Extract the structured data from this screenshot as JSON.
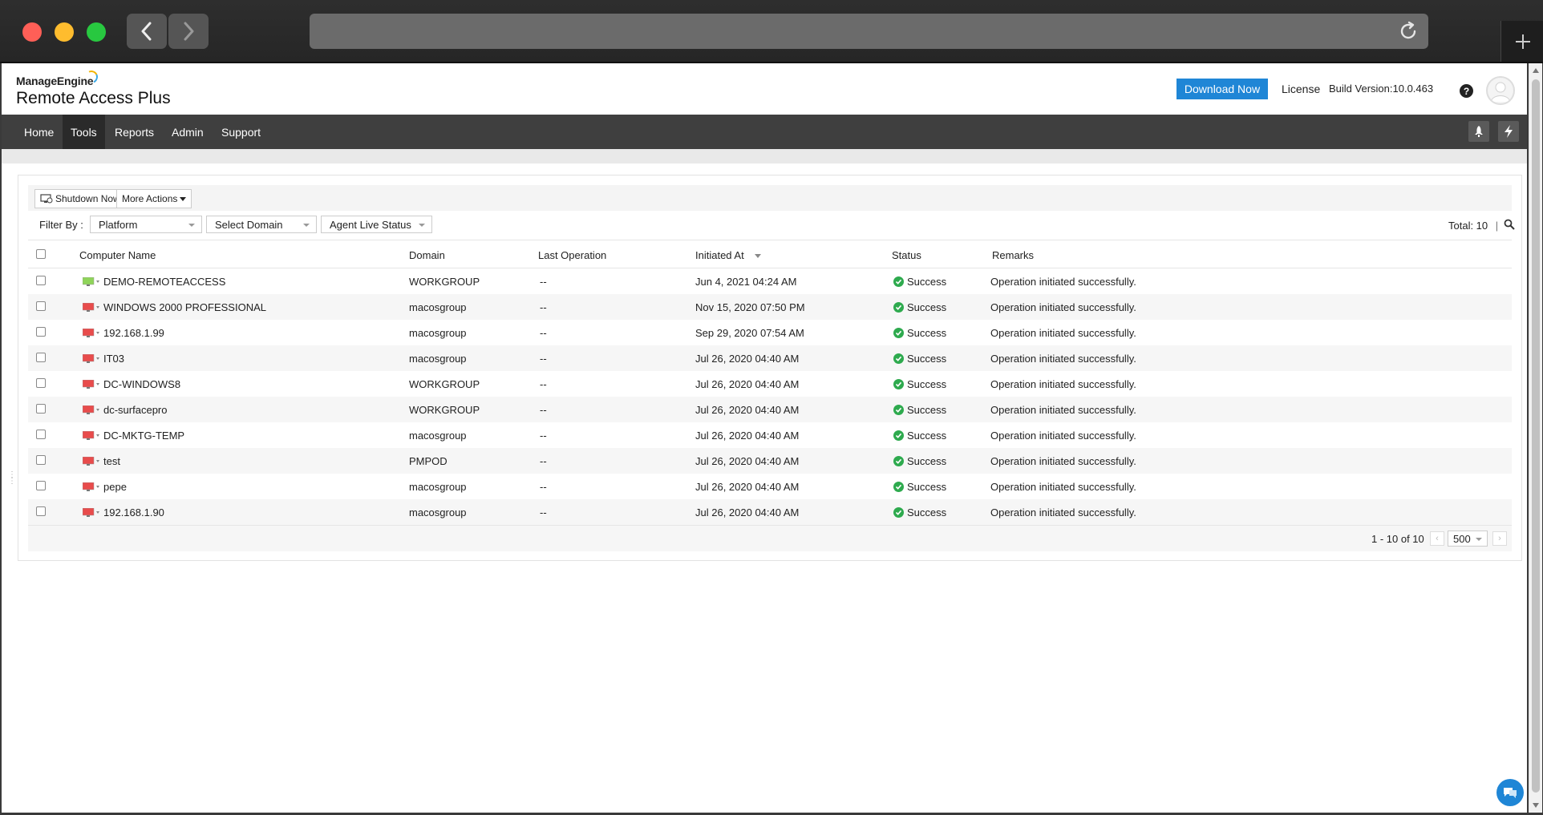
{
  "app": {
    "brand_small": "ManageEngine",
    "brand_name": "Remote Access Plus",
    "download_label": "Download Now",
    "license_label": "License",
    "build_version": "Build Version:10.0.463",
    "help_symbol": "?"
  },
  "menu": {
    "items": [
      {
        "label": "Home"
      },
      {
        "label": "Tools"
      },
      {
        "label": "Reports"
      },
      {
        "label": "Admin"
      },
      {
        "label": "Support"
      }
    ],
    "active": "Tools"
  },
  "toolbar": {
    "shutdown_label": "Shutdown Now",
    "more_actions_label": "More Actions"
  },
  "filters": {
    "label": "Filter By :",
    "platform": "Platform",
    "domain": "Select Domain",
    "agent_status": "Agent Live Status",
    "total": "Total: 10",
    "separator": "|"
  },
  "table": {
    "columns": [
      "Computer Name",
      "Domain",
      "Last Operation",
      "Initiated At",
      "Status",
      "Remarks"
    ],
    "rows": [
      {
        "name": "DEMO-REMOTEACCESS",
        "domain": "WORKGROUP",
        "last_op": "--",
        "initiated": "Jun 4, 2021 04:24 AM",
        "status": "Success",
        "remarks": "Operation initiated successfully.",
        "agent": "online"
      },
      {
        "name": "WINDOWS 2000 PROFESSIONAL",
        "domain": "macosgroup",
        "last_op": "--",
        "initiated": "Nov 15, 2020 07:50 PM",
        "status": "Success",
        "remarks": "Operation initiated successfully.",
        "agent": "offline"
      },
      {
        "name": "192.168.1.99",
        "domain": "macosgroup",
        "last_op": "--",
        "initiated": "Sep 29, 2020 07:54 AM",
        "status": "Success",
        "remarks": "Operation initiated successfully.",
        "agent": "offline"
      },
      {
        "name": "IT03",
        "domain": "macosgroup",
        "last_op": "--",
        "initiated": "Jul 26, 2020 04:40 AM",
        "status": "Success",
        "remarks": "Operation initiated successfully.",
        "agent": "offline"
      },
      {
        "name": "DC-WINDOWS8",
        "domain": "WORKGROUP",
        "last_op": "--",
        "initiated": "Jul 26, 2020 04:40 AM",
        "status": "Success",
        "remarks": "Operation initiated successfully.",
        "agent": "offline"
      },
      {
        "name": "dc-surfacepro",
        "domain": "WORKGROUP",
        "last_op": "--",
        "initiated": "Jul 26, 2020 04:40 AM",
        "status": "Success",
        "remarks": "Operation initiated successfully.",
        "agent": "offline"
      },
      {
        "name": "DC-MKTG-TEMP",
        "domain": "macosgroup",
        "last_op": "--",
        "initiated": "Jul 26, 2020 04:40 AM",
        "status": "Success",
        "remarks": "Operation initiated successfully.",
        "agent": "offline"
      },
      {
        "name": "test",
        "domain": "PMPOD",
        "last_op": "--",
        "initiated": "Jul 26, 2020 04:40 AM",
        "status": "Success",
        "remarks": "Operation initiated successfully.",
        "agent": "offline"
      },
      {
        "name": "pepe",
        "domain": "macosgroup",
        "last_op": "--",
        "initiated": "Jul 26, 2020 04:40 AM",
        "status": "Success",
        "remarks": "Operation initiated successfully.",
        "agent": "offline"
      },
      {
        "name": "192.168.1.90",
        "domain": "macosgroup",
        "last_op": "--",
        "initiated": "Jul 26, 2020 04:40 AM",
        "status": "Success",
        "remarks": "Operation initiated successfully.",
        "agent": "offline"
      }
    ]
  },
  "pager": {
    "range": "1 - 10 of 10",
    "page_size": "500"
  },
  "colors": {
    "accent": "#1f86d6",
    "menubar": "#3f3f3f",
    "success": "#2eaa4e",
    "agent_online": "#8fd45a",
    "agent_offline": "#e84c4c"
  },
  "icons": {
    "back": "chevron-left-icon",
    "forward": "chevron-right-icon",
    "reload": "reload-icon",
    "new_tab": "plus-icon",
    "help": "help-icon",
    "avatar": "user-avatar-icon",
    "rocket": "rocket-icon",
    "flash": "lightning-icon",
    "search": "search-icon",
    "computer": "computer-icon",
    "success": "check-circle-icon",
    "chat": "chat-icon"
  }
}
